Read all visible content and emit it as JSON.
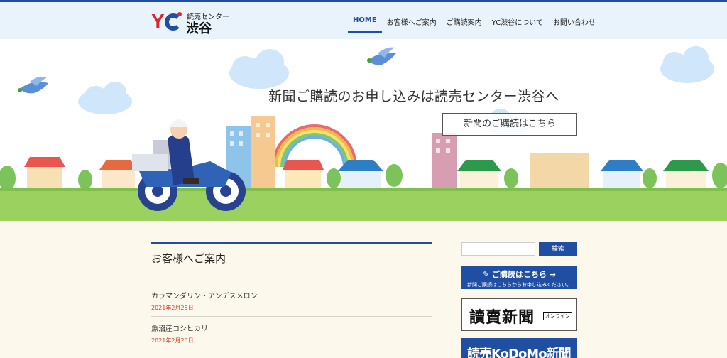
{
  "header": {
    "logo_small": "読売センター",
    "logo_big": "渋谷",
    "logo_mark_y": "Y",
    "nav": [
      {
        "label": "HOME"
      },
      {
        "label": "お客様へご案内"
      },
      {
        "label": "ご購読案内"
      },
      {
        "label": "YC渋谷について"
      },
      {
        "label": "お問い合わせ"
      }
    ]
  },
  "hero": {
    "title": "新聞ご購読のお申し込みは読売センター渋谷へ",
    "button": "新聞のご購読はこちら"
  },
  "main": {
    "heading": "お客様へご案内",
    "posts": [
      {
        "title": "カラマンダリン・アンデスメロン",
        "date": "2021年2月25日"
      },
      {
        "title": "魚沼産コシヒカリ",
        "date": "2021年2月25日"
      }
    ]
  },
  "sidebar": {
    "search_placeholder": "",
    "search_button": "検索",
    "subscribe_title": "ご購読はこちら",
    "subscribe_sub": "新聞ご購読はこちらからお申し込みください。",
    "yomiuri_logo": "讀賣新聞",
    "yomiuri_badge": "オンライン",
    "kodomo_logo": "読売KoDoMo新聞"
  },
  "colors": {
    "brand_blue": "#1f4ea3",
    "brand_red": "#e0242e",
    "date_red": "#d2432c",
    "header_bg": "#e9f3fb",
    "page_bg": "#fdf8ec"
  }
}
